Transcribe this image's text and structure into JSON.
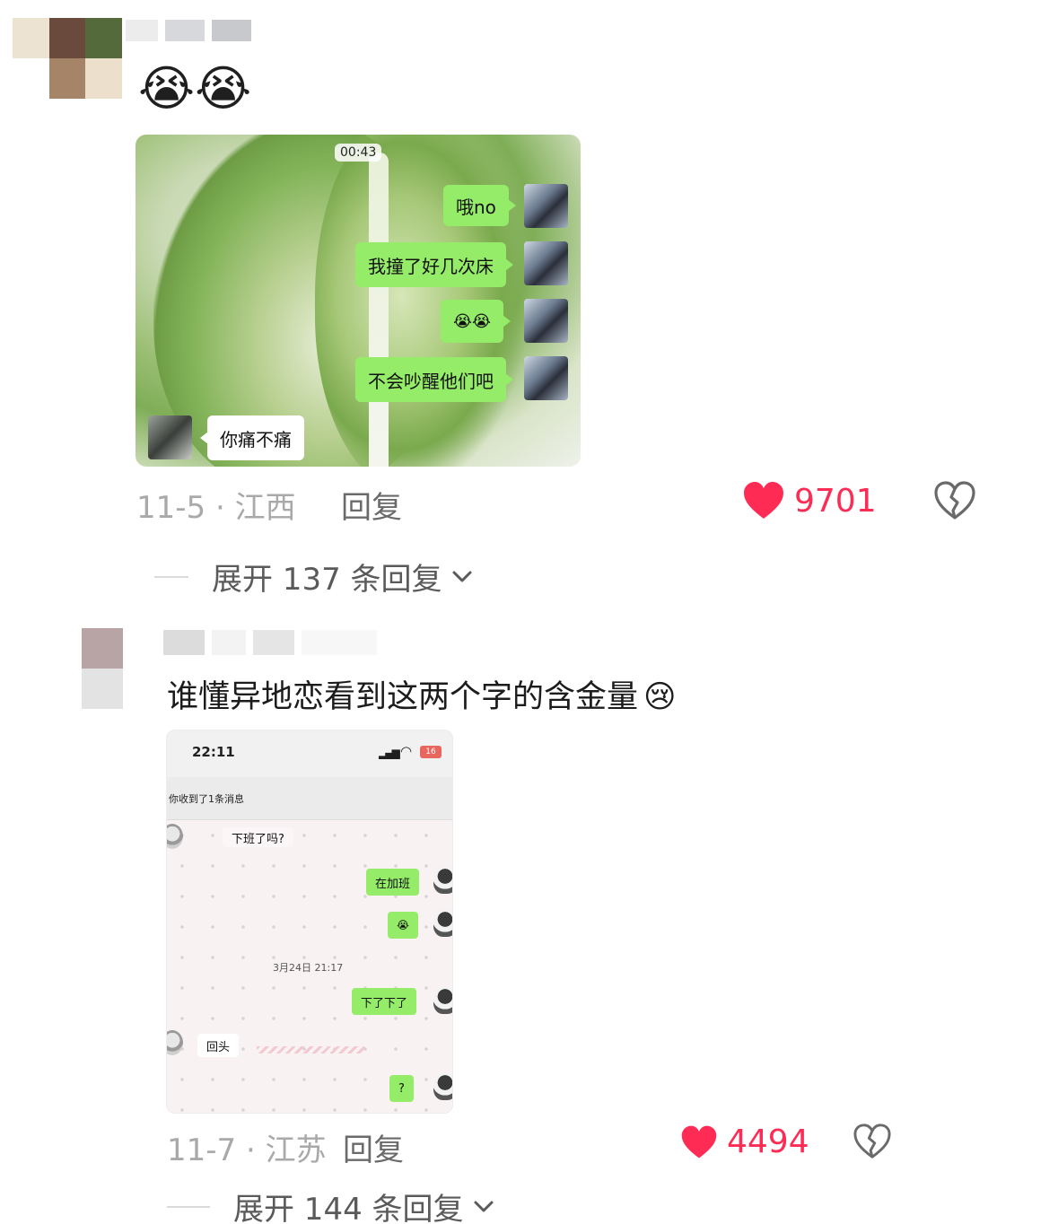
{
  "comments": [
    {
      "emoji_text": "😭😭",
      "video": {
        "duration": "00:43",
        "messages": [
          {
            "side": "right",
            "text": "哦no"
          },
          {
            "side": "right",
            "text": "我撞了好几次床"
          },
          {
            "side": "right",
            "text": "😭😭"
          },
          {
            "side": "right",
            "text": "不会吵醒他们吧"
          },
          {
            "side": "left",
            "text": "你痛不痛"
          }
        ]
      },
      "date_location": "11-5 · 江西",
      "reply_label": "回复",
      "likes": "9701",
      "expand_label": "展开 137 条回复"
    },
    {
      "text": "谁懂异地恋看到这两个字的含金量",
      "text_emoji": "😢",
      "screenshot": {
        "time": "22:11",
        "battery": "16",
        "notice": "你收到了1条消息",
        "messages": [
          {
            "side": "left",
            "text": "下班了吗?"
          },
          {
            "side": "right",
            "text": "在加班"
          },
          {
            "side": "right",
            "text": "😭"
          },
          {
            "side": "right",
            "text": "下了下了"
          },
          {
            "side": "left",
            "text": "回头"
          },
          {
            "side": "right",
            "text": "?"
          }
        ],
        "date_divider": "3月24日 21:17"
      },
      "date_location": "11-7 · 江苏",
      "reply_label": "回复",
      "likes": "4494",
      "expand_label": "展开 144 条回复"
    }
  ],
  "colors": {
    "like_red": "#fe2c55",
    "wechat_green": "#95ec69",
    "meta_gray": "#a9a9a9"
  },
  "icons": [
    "heart-icon",
    "broken-heart-icon",
    "chevron-down-icon"
  ]
}
